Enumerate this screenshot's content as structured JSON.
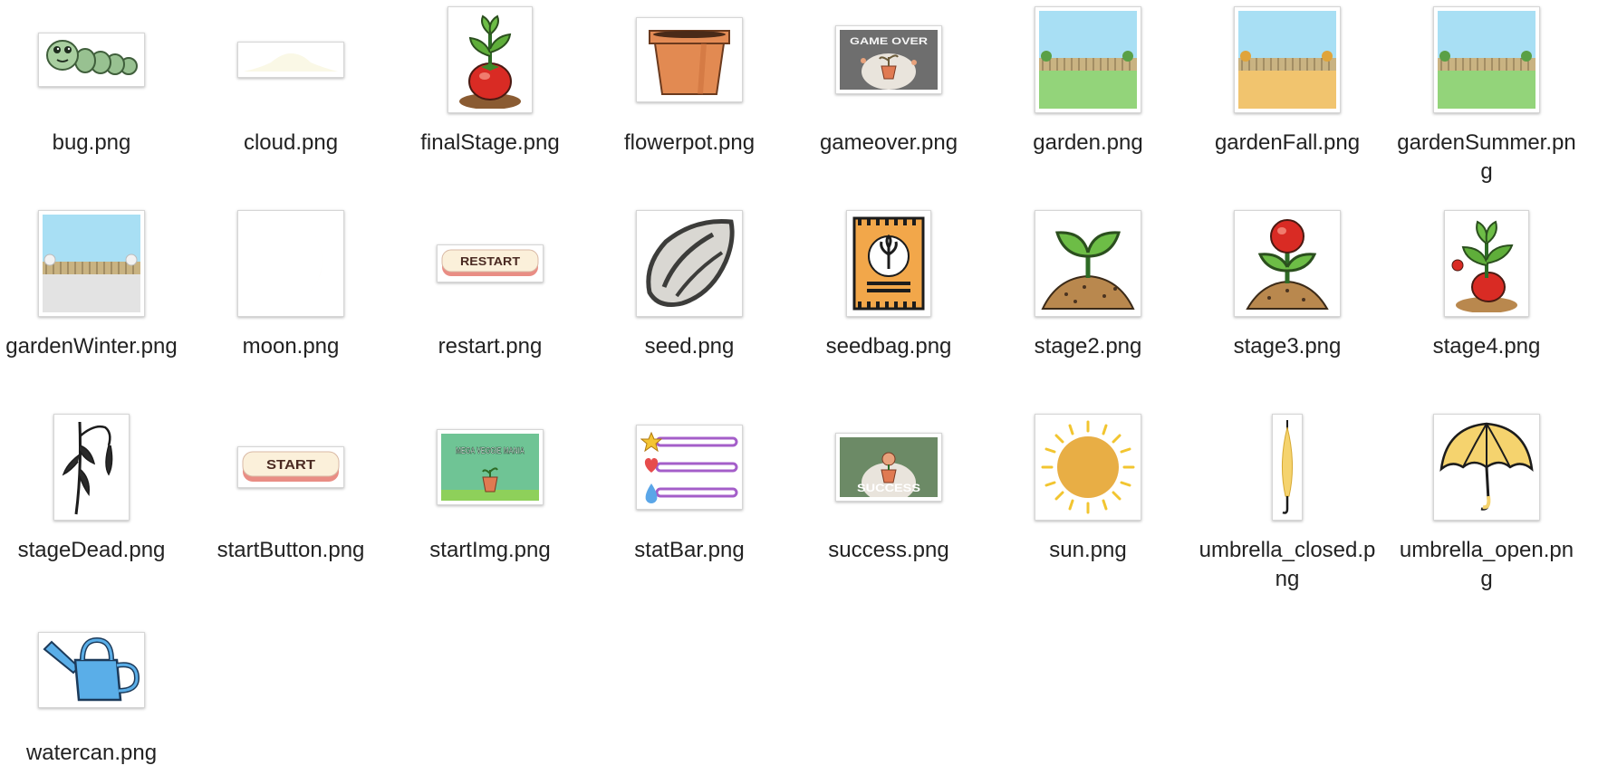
{
  "window": {
    "title": ""
  },
  "files": [
    {
      "name": "bug.png",
      "icon": "bug-icon"
    },
    {
      "name": "cloud.png",
      "icon": "cloud-icon"
    },
    {
      "name": "finalStage.png",
      "icon": "final-stage-plant-icon"
    },
    {
      "name": "flowerpot.png",
      "icon": "flowerpot-icon"
    },
    {
      "name": "gameover.png",
      "icon": "game-over-icon",
      "image_text": "GAME OVER"
    },
    {
      "name": "garden.png",
      "icon": "garden-scene-icon"
    },
    {
      "name": "gardenFall.png",
      "icon": "garden-fall-scene-icon"
    },
    {
      "name": "gardenSummer.png",
      "icon": "garden-summer-scene-icon"
    },
    {
      "name": "gardenWinter.png",
      "icon": "garden-winter-scene-icon"
    },
    {
      "name": "moon.png",
      "icon": "moon-icon"
    },
    {
      "name": "restart.png",
      "icon": "restart-button-icon",
      "image_text": "RESTART"
    },
    {
      "name": "seed.png",
      "icon": "seed-icon"
    },
    {
      "name": "seedbag.png",
      "icon": "seedbag-icon"
    },
    {
      "name": "stage2.png",
      "icon": "sprout-stage2-icon"
    },
    {
      "name": "stage3.png",
      "icon": "plant-stage3-icon"
    },
    {
      "name": "stage4.png",
      "icon": "plant-stage4-icon"
    },
    {
      "name": "stageDead.png",
      "icon": "dead-plant-icon"
    },
    {
      "name": "startButton.png",
      "icon": "start-button-icon",
      "image_text": "START"
    },
    {
      "name": "startImg.png",
      "icon": "start-screen-icon",
      "image_text": "MEGA VEGGIE MANIA"
    },
    {
      "name": "statBar.png",
      "icon": "stat-bar-icon"
    },
    {
      "name": "success.png",
      "icon": "success-icon",
      "image_text": "SUCCESS"
    },
    {
      "name": "sun.png",
      "icon": "sun-icon"
    },
    {
      "name": "umbrella_closed.png",
      "icon": "umbrella-closed-icon"
    },
    {
      "name": "umbrella_open.png",
      "icon": "umbrella-open-icon"
    },
    {
      "name": "watercan.png",
      "icon": "watering-can-icon"
    }
  ]
}
